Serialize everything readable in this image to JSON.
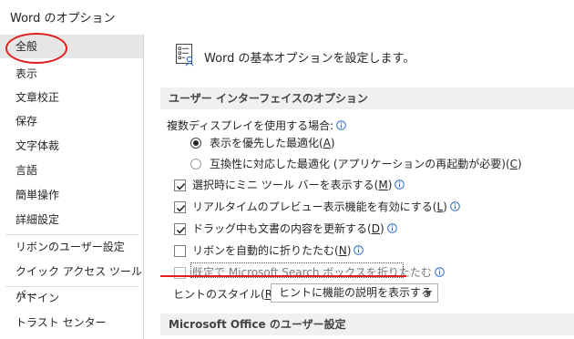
{
  "window": {
    "title": "Word のオプション"
  },
  "sidebar": {
    "items": [
      {
        "label": "全般",
        "selected": true
      },
      {
        "label": "表示"
      },
      {
        "label": "文章校正"
      },
      {
        "label": "保存"
      },
      {
        "label": "文字体裁"
      },
      {
        "label": "言語"
      },
      {
        "label": "簡単操作"
      },
      {
        "label": "詳細設定"
      },
      {
        "label": "リボンのユーザー設定"
      },
      {
        "label": "クイック アクセス ツール バー"
      },
      {
        "label": "アドイン"
      },
      {
        "label": "トラスト センター"
      }
    ]
  },
  "main": {
    "header_text": "Word の基本オプションを設定します。",
    "header_icon": "general-options-icon",
    "section1_title": "ユーザー インターフェイスのオプション",
    "multi_display_label": "複数ディスプレイを使用する場合:",
    "radio_optimize_appearance": {
      "label": "表示を優先した最適化",
      "key": "A",
      "checked": true
    },
    "radio_optimize_compat": {
      "label": "互換性に対応した最適化 (アプリケーションの再起動が必要)",
      "key": "C",
      "checked": false
    },
    "checkbox_mini_toolbar": {
      "label": "選択時にミニ ツール バーを表示する",
      "key": "M",
      "checked": true
    },
    "checkbox_live_preview": {
      "label": "リアルタイムのプレビュー表示機能を有効にする",
      "key": "L",
      "checked": true
    },
    "checkbox_update_drag": {
      "label": "ドラッグ中も文書の内容を更新する",
      "key": "D",
      "checked": true
    },
    "checkbox_collapse_ribbon": {
      "label": "リボンを自動的に折りたたむ",
      "key": "N",
      "checked": false
    },
    "checkbox_collapse_search": {
      "label": "既定で Microsoft Search ボックスを折りたたむ",
      "checked": false,
      "disabled": true
    },
    "screentip_label": "ヒントのスタイル",
    "screentip_key": "R",
    "screentip_value": "ヒントに機能の説明を表示する",
    "section2_title": "Microsoft Office のユーザー設定"
  },
  "colors": {
    "annotation_red": "#e01f1f",
    "selected_bg": "#e6e6e6",
    "section_bg": "#f0f0f0",
    "info_blue": "#2b6cc4"
  }
}
